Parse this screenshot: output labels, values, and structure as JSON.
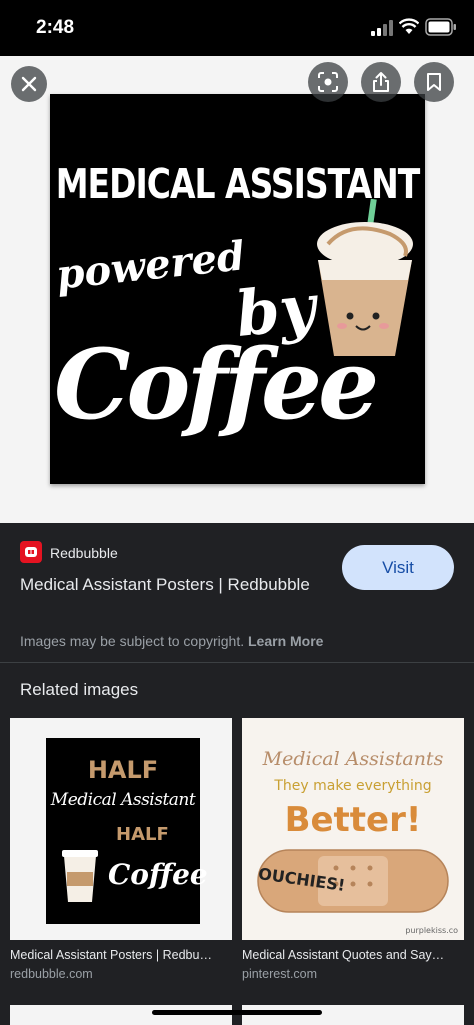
{
  "status_bar": {
    "time": "2:48"
  },
  "viewer": {
    "poster_text": {
      "line1": "MEDICAL ASSISTANT",
      "line2": "powered",
      "line3": "by",
      "line4": "Coffee"
    },
    "icons": [
      "close-icon",
      "lens-icon",
      "share-icon",
      "bookmark-icon"
    ]
  },
  "result": {
    "source": "Redbubble",
    "title": "Medical Assistant Posters | Redbubble",
    "visit_label": "Visit",
    "copyright_text": "Images may be subject to copyright.",
    "learn_more": "Learn More"
  },
  "related": {
    "heading": "Related images",
    "items": [
      {
        "title": "Medical Assistant Posters | Redbu…",
        "source": "redbubble.com",
        "thumb_text": [
          "HALF",
          "Medical Assistant",
          "HALF",
          "Coffee"
        ]
      },
      {
        "title": "Medical Assistant Quotes and Say…",
        "source": "pinterest.com",
        "thumb_text": [
          "Medical Assistants",
          "They make everything",
          "Better!",
          "OUCHIES!",
          "purplekiss.co"
        ]
      }
    ]
  },
  "colors": {
    "background": "#202124",
    "visit_button": "#d2e3fc",
    "visit_text": "#174ea6",
    "source_logo": "#e41321"
  }
}
